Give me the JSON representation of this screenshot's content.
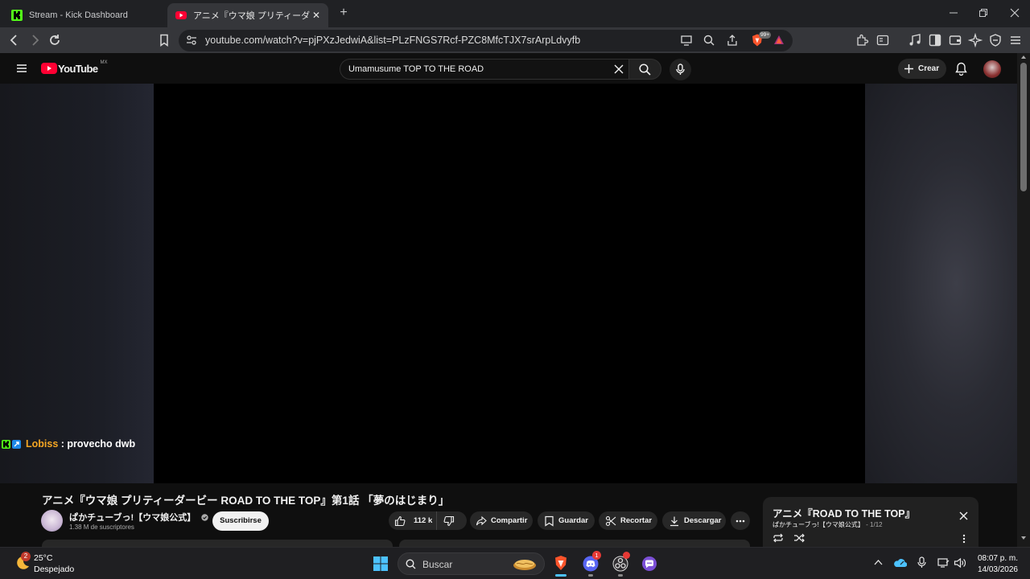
{
  "browser": {
    "tabs": [
      {
        "label": "Stream - Kick Dashboard",
        "icon": "kick-icon",
        "active": false
      },
      {
        "label": "アニメ『ウマ娘 プリティーダービー ROAD",
        "icon": "youtube-icon",
        "active": true
      }
    ],
    "url": "youtube.com/watch?v=pjPXzJedwiA&list=PLzFNGS7Rcf-PZC8MfcTJX7srArpLdvyfb",
    "brave_badge": "99+"
  },
  "youtube": {
    "logo_text": "YouTube",
    "region": "MX",
    "search_value": "Umamusume TOP TO THE ROAD",
    "create_label": "Crear"
  },
  "chat": {
    "user": "Lobiss",
    "separator": " : ",
    "message": "provecho dwb",
    "user_color": "#f5a623"
  },
  "video": {
    "title": "アニメ『ウマ娘 プリティーダービー ROAD TO THE TOP』第1話 「夢のはじまり」",
    "channel": "ぱかチューブっ!【ウマ娘公式】",
    "subscribers": "1.38 M de suscriptores",
    "subscribe_label": "Suscribirse",
    "likes": "112 k",
    "share_label": "Compartir",
    "save_label": "Guardar",
    "clip_label": "Recortar",
    "download_label": "Descargar"
  },
  "playlist": {
    "title": "アニメ『ROAD TO THE TOP』",
    "channel": "ぱかチューブっ!【ウマ娘公式】",
    "position": " - 1/12"
  },
  "taskbar": {
    "weather_temp": "25°C",
    "weather_desc": "Despejado",
    "weather_badge": "2",
    "search_label": "Buscar",
    "discord_badge": "1",
    "time": "08:07 p. m.",
    "date": "14/03/2026"
  },
  "colors": {
    "youtube_red": "#ff0033",
    "kick_green": "#53fc18",
    "brave_orange": "#fb542b"
  }
}
